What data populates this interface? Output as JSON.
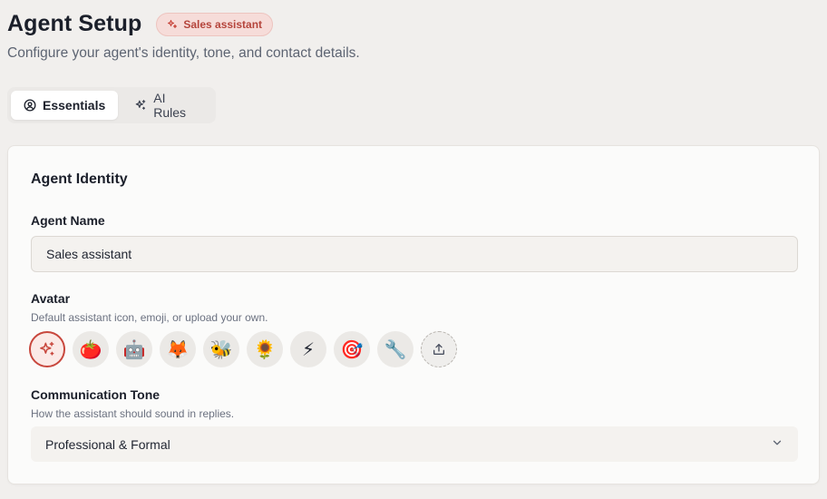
{
  "header": {
    "title": "Agent Setup",
    "badge_label": "Sales assistant",
    "subtitle": "Configure your agent's identity, tone, and contact details."
  },
  "tabs": [
    {
      "label": "Essentials",
      "icon": "user-circle-icon",
      "active": true
    },
    {
      "label": "AI Rules",
      "icon": "sparkles-icon",
      "active": false
    }
  ],
  "card": {
    "title": "Agent Identity",
    "agent_name": {
      "label": "Agent Name",
      "value": "Sales assistant"
    },
    "avatar": {
      "label": "Avatar",
      "hint": "Default assistant icon, emoji, or upload your own.",
      "options": [
        {
          "name": "sparkles-icon",
          "glyph": "",
          "selected": true
        },
        {
          "name": "tomato-emoji",
          "glyph": "🍅"
        },
        {
          "name": "robot-emoji",
          "glyph": "🤖"
        },
        {
          "name": "fox-emoji",
          "glyph": "🦊"
        },
        {
          "name": "bee-emoji",
          "glyph": "🐝"
        },
        {
          "name": "sunflower-emoji",
          "glyph": "🌻"
        },
        {
          "name": "lightning-emoji",
          "glyph": "⚡"
        },
        {
          "name": "target-emoji",
          "glyph": "🎯"
        },
        {
          "name": "wrench-emoji",
          "glyph": "🔧"
        },
        {
          "name": "upload-icon",
          "glyph": ""
        }
      ]
    },
    "tone": {
      "label": "Communication Tone",
      "hint": "How the assistant should sound in replies.",
      "selected": "Professional & Formal"
    }
  },
  "colors": {
    "accent": "#c8473d",
    "badge_bg": "#f6dcd9",
    "background": "#f1efed"
  }
}
